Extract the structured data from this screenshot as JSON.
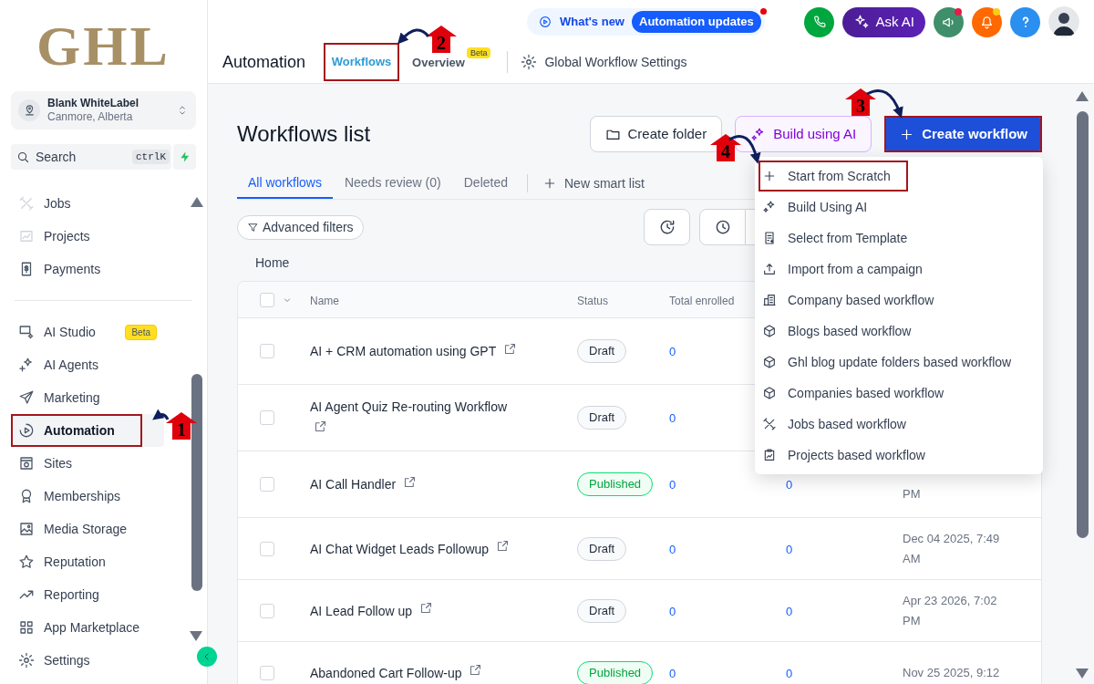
{
  "sidebar": {
    "logo": "GHL",
    "account": {
      "name": "Blank WhiteLabel",
      "location": "Canmore, Alberta"
    },
    "search": {
      "placeholder": "Search",
      "shortcut": "ctrlK"
    },
    "groups": [
      [
        {
          "label": "Jobs",
          "selected": false
        },
        {
          "label": "Projects",
          "selected": false
        },
        {
          "label": "Payments",
          "selected": false
        }
      ],
      [
        {
          "label": "AI Studio",
          "selected": false,
          "badge": "Beta"
        },
        {
          "label": "AI Agents",
          "selected": false
        },
        {
          "label": "Marketing",
          "selected": false
        },
        {
          "label": "Automation",
          "selected": true
        },
        {
          "label": "Sites",
          "selected": false
        },
        {
          "label": "Memberships",
          "selected": false
        },
        {
          "label": "Media Storage",
          "selected": false
        },
        {
          "label": "Reputation",
          "selected": false
        },
        {
          "label": "Reporting",
          "selected": false
        },
        {
          "label": "App Marketplace",
          "selected": false
        },
        {
          "label": "Settings",
          "selected": false
        }
      ]
    ]
  },
  "header": {
    "whats_new": {
      "label": "What's new",
      "pill": "Automation updates",
      "unread": true
    },
    "ask_ai": "Ask AI",
    "alerts": [
      {
        "unread": true,
        "color": "#e11d48"
      },
      {
        "unread": true,
        "color": "#facc15"
      }
    ],
    "title": "Automation",
    "tabs": [
      {
        "label": "Workflows",
        "selected": true
      },
      {
        "label": "Overview",
        "selected": false,
        "badge": "Beta"
      }
    ],
    "settings_link": "Global Workflow Settings"
  },
  "page": {
    "title": "Workflows list",
    "buttons": [
      {
        "label": "Create folder",
        "kind": "folder"
      },
      {
        "label": "Build using AI",
        "kind": "ai"
      },
      {
        "label": "Create workflow",
        "kind": "primary"
      }
    ],
    "tabs": [
      {
        "label": "All workflows",
        "selected": true
      },
      {
        "label": "Needs review (0)",
        "selected": false
      },
      {
        "label": "Deleted",
        "selected": false
      }
    ],
    "new_smart_list": "New smart list",
    "filters": "Advanced filters",
    "breadcrumb": "Home",
    "table": {
      "all_checked": false,
      "columns": [
        "Name",
        "Status",
        "Total enrolled"
      ],
      "rows": [
        {
          "checked": false,
          "name": "AI + CRM automation using GPT",
          "status": {
            "label": "Draft",
            "kind": "draft"
          },
          "total_enrolled": "0"
        },
        {
          "checked": false,
          "name": "AI Agent Quiz Re-routing Workflow",
          "status": {
            "label": "Draft",
            "kind": "draft"
          },
          "total_enrolled": "0"
        },
        {
          "checked": false,
          "name": "AI Call Handler",
          "status": {
            "label": "Published",
            "kind": "published"
          },
          "total_enrolled": "0",
          "column_5": "0",
          "column_6": "PM"
        },
        {
          "checked": false,
          "name": "AI Chat Widget Leads Followup",
          "status": {
            "label": "Draft",
            "kind": "draft"
          },
          "total_enrolled": "0",
          "column_5": "0",
          "column_6": "Dec 04 2025, 7:49 AM"
        },
        {
          "checked": false,
          "name": "AI Lead Follow up",
          "status": {
            "label": "Draft",
            "kind": "draft"
          },
          "total_enrolled": "0",
          "column_5": "0",
          "column_6": "Apr 23 2026, 7:02 PM"
        },
        {
          "checked": false,
          "name": "Abandoned Cart Follow-up",
          "status": {
            "label": "Published",
            "kind": "published"
          },
          "total_enrolled": "0",
          "column_5": "0",
          "column_6": "Nov 25 2025, 9:12"
        }
      ]
    }
  },
  "menu": {
    "items": [
      {
        "label": "Start from Scratch"
      },
      {
        "label": "Build Using AI"
      },
      {
        "label": "Select from Template"
      },
      {
        "label": "Import from a campaign"
      },
      {
        "label": "Company based workflow"
      },
      {
        "label": "Blogs based workflow"
      },
      {
        "label": "Ghl blog update folders based workflow"
      },
      {
        "label": "Companies based workflow"
      },
      {
        "label": "Jobs based workflow"
      },
      {
        "label": "Projects based workflow"
      }
    ]
  },
  "annotations": {
    "steps": [
      {
        "number": "1"
      },
      {
        "number": "2"
      },
      {
        "number": "3"
      },
      {
        "number": "4"
      }
    ]
  }
}
